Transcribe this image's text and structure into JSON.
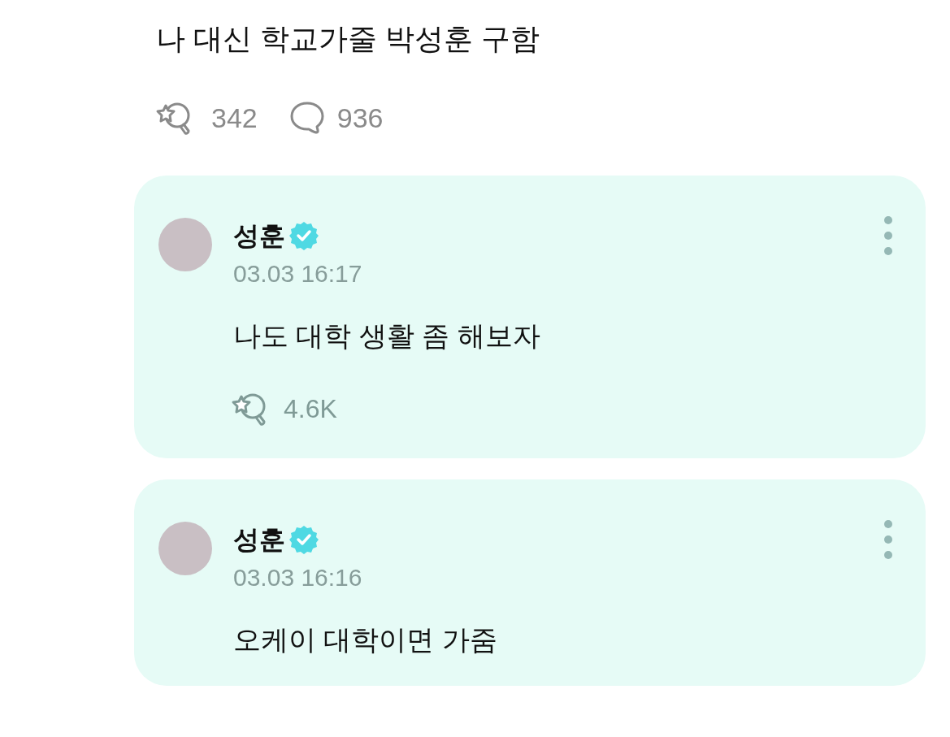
{
  "post": {
    "text": "나 대신 학교가줄 박성훈 구함",
    "reactions": "342",
    "comments": "936"
  },
  "replies": [
    {
      "author": "성훈",
      "verified": true,
      "time": "03.03 16:17",
      "text": "나도 대학 생활 좀 해보자",
      "reactions": "4.6K"
    },
    {
      "author": "성훈",
      "verified": true,
      "time": "03.03 16:16",
      "text": "오케이 대학이면 가줌"
    }
  ]
}
